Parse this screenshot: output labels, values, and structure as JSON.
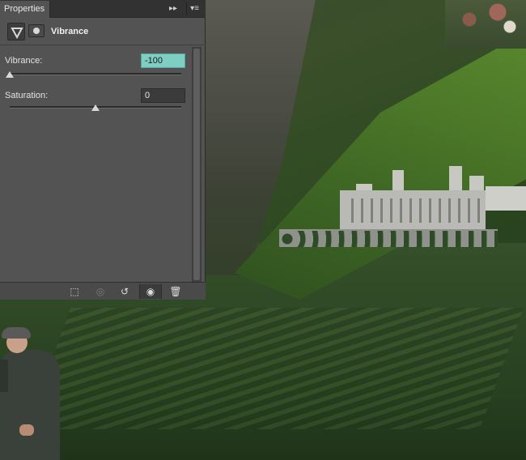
{
  "panel": {
    "tab_label": "Properties",
    "collapse_glyph": "▸▸",
    "menu_glyph": "▾≡",
    "adjustment_icon": "vibrance-triangle-icon",
    "mask_icon": "layer-mask-icon",
    "adjustment_title": "Vibrance"
  },
  "vibrance": {
    "label": "Vibrance:",
    "value": "-100",
    "min": -100,
    "max": 100,
    "current": -100
  },
  "saturation": {
    "label": "Saturation:",
    "value": "0",
    "min": -100,
    "max": 100,
    "current": 0
  },
  "bottom_toolbar": {
    "clip_icon": "clip-to-layer-icon",
    "view_previous_icon": "view-previous-state-icon",
    "reset_icon": "reset-icon",
    "visibility_icon": "eye-icon",
    "delete_icon": "trash-icon",
    "clip_glyph": "⬚",
    "view_prev_glyph": "◎",
    "reset_glyph": "↺",
    "eye_glyph": "◉",
    "trash_glyph": "🗑"
  },
  "colors": {
    "panel_bg": "#535353",
    "field_highlight": "#7ecec4"
  }
}
